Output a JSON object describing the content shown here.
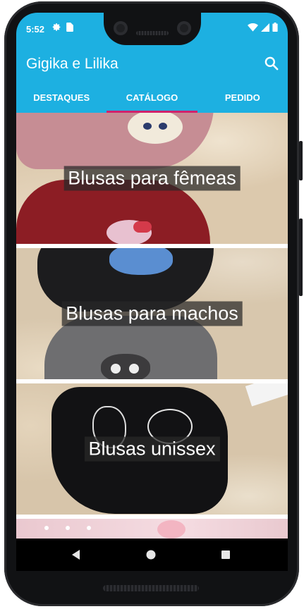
{
  "status": {
    "time": "5:52",
    "left_icons": [
      "gear-icon",
      "sim-card-icon"
    ],
    "right_icons": [
      "wifi-icon",
      "signal-icon",
      "battery-icon"
    ]
  },
  "app_bar": {
    "title": "Gigika e Lilika",
    "search_icon": "search-icon"
  },
  "tabs": [
    {
      "label": "DESTAQUES",
      "selected": false
    },
    {
      "label": "CATÁLOGO",
      "selected": true
    },
    {
      "label": "PEDIDO",
      "selected": false
    }
  ],
  "catalog": {
    "items": [
      {
        "label": "Blusas para fêmeas"
      },
      {
        "label": "Blusas para machos"
      },
      {
        "label": "Blusas unissex"
      }
    ]
  },
  "nav": {
    "back_icon": "back-triangle-icon",
    "home_icon": "home-circle-icon",
    "recent_icon": "recent-square-icon"
  },
  "colors": {
    "primary": "#1db0e1",
    "accent": "#d0226c",
    "on_primary": "#ffffff",
    "caption_bg": "#282828"
  }
}
